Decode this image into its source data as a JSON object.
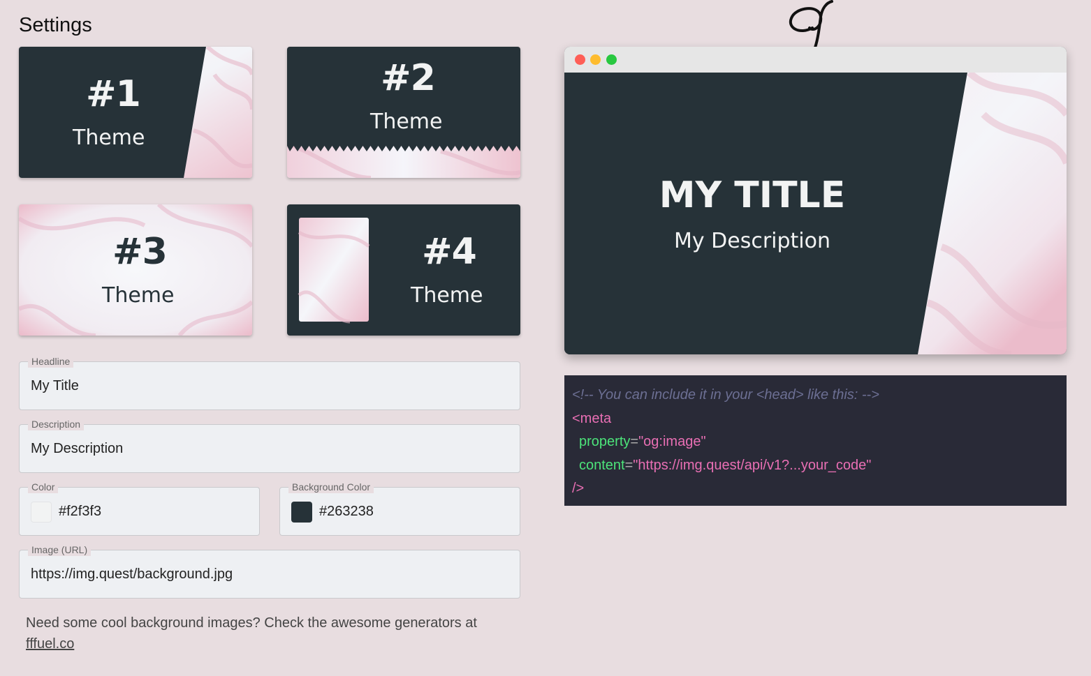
{
  "page": {
    "title": "Settings"
  },
  "themes": [
    {
      "number": "#1",
      "label": "Theme"
    },
    {
      "number": "#2",
      "label": "Theme"
    },
    {
      "number": "#3",
      "label": "Theme"
    },
    {
      "number": "#4",
      "label": "Theme"
    }
  ],
  "form": {
    "headline": {
      "legend": "Headline",
      "value": "My Title"
    },
    "description": {
      "legend": "Description",
      "value": "My Description"
    },
    "color": {
      "legend": "Color",
      "value": "#f2f3f3"
    },
    "background_color": {
      "legend": "Background Color",
      "value": "#263238"
    },
    "image_url": {
      "legend": "Image (URL)",
      "value": "https://img.quest/background.jpg"
    }
  },
  "hint": {
    "text": "Need some cool background images? Check the awesome generators at",
    "link": "fffuel.co"
  },
  "preview": {
    "title": "MY TITLE",
    "description": "My Description"
  },
  "code": {
    "comment": "<!-- You can include it in your <head> like this: -->",
    "open_tag": "<meta",
    "attr1_name": "property",
    "attr1_value": "\"og:image\"",
    "attr2_name": "content",
    "attr2_value": "\"https://img.quest/api/v1?...your_code\"",
    "close_tag": "/>",
    "equals": "="
  },
  "colors": {
    "page_bg": "#e8dde0",
    "dark": "#263238",
    "light": "#f2f3f3",
    "code_bg": "#292a37",
    "traffic_red": "#fe5f57",
    "traffic_yellow": "#febc2e",
    "traffic_green": "#28c840"
  }
}
